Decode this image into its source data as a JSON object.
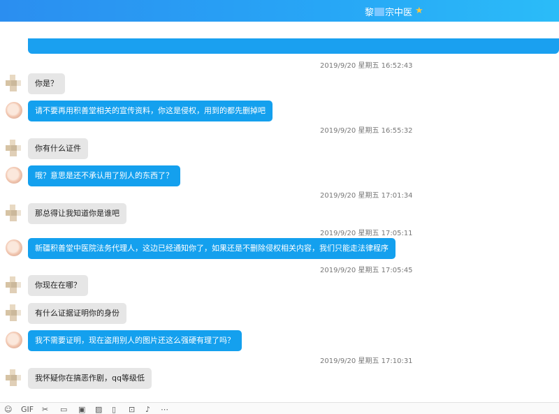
{
  "header": {
    "name_prefix": "黎",
    "name_suffix": "宗中医",
    "star": "★"
  },
  "messages": [
    {
      "type": "time",
      "text": "2019/9/20 星期五 16:52:43"
    },
    {
      "type": "in",
      "text": "你是？"
    },
    {
      "type": "out",
      "text": "请不要再用积善堂相关的宣传资料，你这是侵权，用到的都先删掉吧"
    },
    {
      "type": "time",
      "text": "2019/9/20 星期五 16:55:32"
    },
    {
      "type": "in",
      "text": "你有什么证件"
    },
    {
      "type": "out",
      "text": "哦？意思是还不承认用了别人的东西了？"
    },
    {
      "type": "time",
      "text": "2019/9/20 星期五 17:01:34"
    },
    {
      "type": "in",
      "text": "那总得让我知道你是谁吧"
    },
    {
      "type": "time",
      "text": "2019/9/20 星期五 17:05:11"
    },
    {
      "type": "out",
      "text": "新疆积善堂中医院法务代理人，这边已经通知你了，如果还是不删除侵权相关内容，我们只能走法律程序"
    },
    {
      "type": "time",
      "text": "2019/9/20 星期五 17:05:45"
    },
    {
      "type": "in",
      "text": "你现在在哪？"
    },
    {
      "type": "in",
      "text": "有什么证据证明你的身份"
    },
    {
      "type": "out",
      "text": "我不需要证明，现在盗用别人的图片还这么强硬有理了吗？"
    },
    {
      "type": "time",
      "text": "2019/9/20 星期五 17:10:31"
    },
    {
      "type": "in",
      "text": "我怀疑你在搞恶作剧，qq等级低"
    }
  ],
  "toolbar": {
    "items": [
      {
        "name": "emoji-icon",
        "glyph": "☺"
      },
      {
        "name": "gif-icon",
        "glyph": "GIF"
      },
      {
        "name": "screenshot-icon",
        "glyph": "✂"
      },
      {
        "name": "folder-icon",
        "glyph": "▭"
      },
      {
        "name": "image-icon",
        "glyph": "▣"
      },
      {
        "name": "photo-icon",
        "glyph": "▨"
      },
      {
        "name": "phone-icon",
        "glyph": "▯"
      },
      {
        "name": "red-packet-icon",
        "glyph": "⊡"
      },
      {
        "name": "voice-icon",
        "glyph": "♪"
      },
      {
        "name": "more-icon",
        "glyph": "⋯"
      }
    ]
  }
}
